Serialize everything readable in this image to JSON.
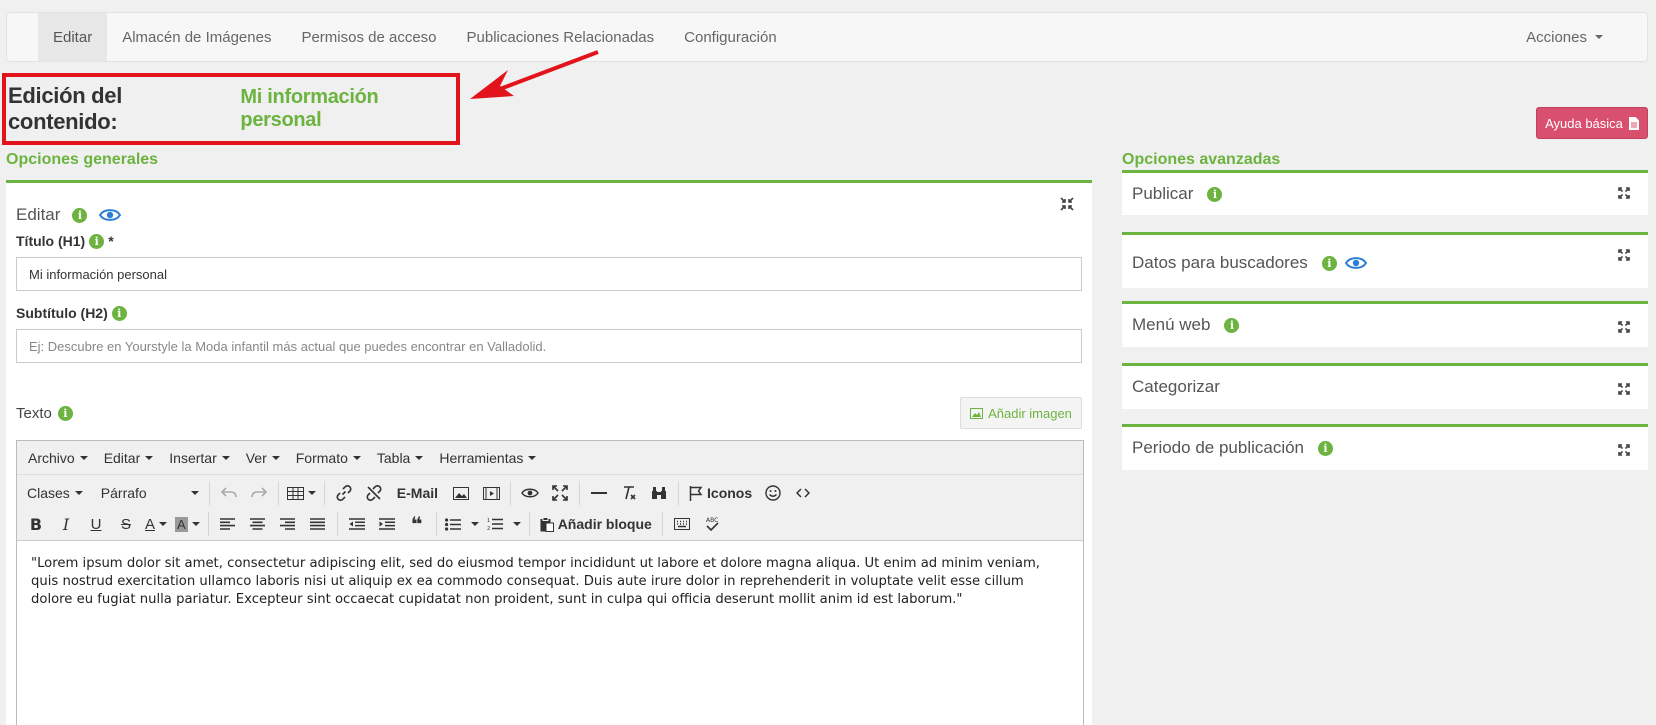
{
  "nav": {
    "tabs": [
      {
        "label": "Editar",
        "active": true
      },
      {
        "label": "Almacén de Imágenes",
        "active": false
      },
      {
        "label": "Permisos de acceso",
        "active": false
      },
      {
        "label": "Publicaciones Relacionadas",
        "active": false
      },
      {
        "label": "Configuración",
        "active": false
      }
    ],
    "actions_label": "Acciones"
  },
  "page_title": {
    "label": "Edición del contenido:",
    "value": "Mi información personal"
  },
  "help_button": {
    "label": "Ayuda básica"
  },
  "general": {
    "section_title": "Opciones generales",
    "panel_title": "Editar",
    "title_field": {
      "label": "Título (H1)",
      "required_mark": "*",
      "value": "Mi información personal"
    },
    "subtitle_field": {
      "label": "Subtítulo (H2)",
      "placeholder": "Ej: Descubre en Yourstyle la Moda infantil más actual que puedes encontrar en Valladolid."
    },
    "text_label": "Texto",
    "add_image_label": "Añadir imagen"
  },
  "editor": {
    "menus": [
      "Archivo",
      "Editar",
      "Insertar",
      "Ver",
      "Formato",
      "Tabla",
      "Herramientas"
    ],
    "classes_label": "Clases",
    "paragraph_label": "Párrafo",
    "email_label": "E-Mail",
    "icons_label": "Iconos",
    "add_block_label": "Añadir bloque",
    "content": "\"Lorem ipsum dolor sit amet, consectetur adipiscing elit, sed do eiusmod tempor incididunt ut labore et dolore magna aliqua. Ut enim ad minim veniam, quis nostrud exercitation ullamco laboris nisi ut aliquip ex ea commodo consequat. Duis aute irure dolor in reprehenderit in voluptate velit esse cillum dolore eu fugiat nulla pariatur. Excepteur sint occaecat cupidatat non proident, sunt in culpa qui officia deserunt mollit anim id est laborum.\""
  },
  "advanced": {
    "section_title": "Opciones avanzadas",
    "panels": [
      {
        "label": "Publicar"
      },
      {
        "label": "Datos para buscadores"
      },
      {
        "label": "Menú web"
      },
      {
        "label": "Categorizar"
      },
      {
        "label": "Periodo de publicación"
      }
    ]
  },
  "colors": {
    "accent": "#6cb33f",
    "help": "#d9506f",
    "highlight": "#e3131b",
    "eye": "#2a7fd4"
  }
}
